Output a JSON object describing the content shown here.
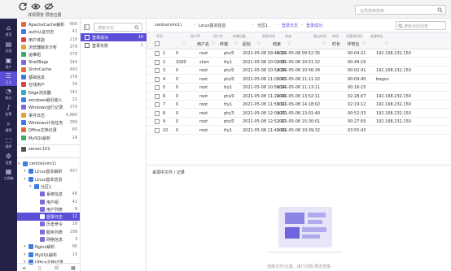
{
  "topbar": {
    "label": "详情预览 预览位置",
    "search_placeholder": "全局搜索搜索"
  },
  "rail": {
    "items": [
      {
        "label": "首页",
        "icon": "home-icon",
        "active": false
      },
      {
        "label": "文档",
        "icon": "doc-icon",
        "active": false
      },
      {
        "label": "资产",
        "icon": "asset-icon",
        "active": false
      },
      {
        "label": "日志",
        "icon": "log-icon",
        "active": true
      },
      {
        "label": "统计",
        "icon": "chart-icon",
        "active": false
      },
      {
        "label": "告警",
        "icon": "bell-icon",
        "active": false
      },
      {
        "label": "搜索",
        "icon": "search-icon",
        "active": false
      },
      {
        "label": "插件",
        "icon": "plugin-icon",
        "active": false
      },
      {
        "label": "设置",
        "icon": "gear-icon",
        "active": false
      },
      {
        "label": "工具箱",
        "icon": "toolbox-icon",
        "active": false
      }
    ]
  },
  "tree_top": [
    {
      "label": "ApacheCache解析",
      "count": "669"
    },
    {
      "label": "auth认证日志",
      "count": "41"
    },
    {
      "label": "用户体验",
      "count": "118"
    },
    {
      "label": "浏览器版本分析",
      "count": "379"
    },
    {
      "label": "运维组",
      "count": "278"
    },
    {
      "label": "ShellBags",
      "count": "244"
    },
    {
      "label": "ShimCache",
      "count": "493"
    },
    {
      "label": "基础信息",
      "count": "178"
    },
    {
      "label": "在线用户",
      "count": "34"
    },
    {
      "label": "Edge浏览器",
      "count": "142"
    },
    {
      "label": "windows最近输入",
      "count": "22"
    },
    {
      "label": "Windows运行记录",
      "count": "170"
    },
    {
      "label": "事件日志",
      "count": "4,880"
    },
    {
      "label": "Windows计划任务",
      "count": "289"
    },
    {
      "label": "Office文档记录",
      "count": "65"
    },
    {
      "label": "MySQL解析",
      "count": "14"
    }
  ],
  "tree_server": "server.101",
  "tree_bottom": [
    {
      "label": "centos(vim1)",
      "count": "",
      "indent": 0
    },
    {
      "label": "Linux基本解析",
      "count": "437",
      "indent": 1
    },
    {
      "label": "Linux基本信息",
      "count": "",
      "indent": 1
    },
    {
      "label": "分区1",
      "count": "",
      "indent": 2
    },
    {
      "label": "系统信息",
      "count": "48",
      "indent": 3
    },
    {
      "label": "用户组",
      "count": "43",
      "indent": 3
    },
    {
      "label": "用户列表",
      "count": "8",
      "indent": 3
    },
    {
      "label": "登录日志",
      "count": "11",
      "indent": 3,
      "selected": true
    },
    {
      "label": "历史命令",
      "count": "18",
      "indent": 3
    },
    {
      "label": "服务列表",
      "count": "198",
      "indent": 3
    },
    {
      "label": "网络信息",
      "count": "3",
      "indent": 3
    },
    {
      "label": "Nginx解析",
      "count": "96",
      "indent": 1
    },
    {
      "label": "MySQL解析",
      "count": "19",
      "indent": 1
    },
    {
      "label": "Office文档记录",
      "count": "",
      "indent": 1
    }
  ],
  "logpanel": {
    "search_placeholder": "搜索日志",
    "items": [
      {
        "label": "登录成功",
        "count": "10",
        "selected": true
      },
      {
        "label": "登录失败",
        "count": "1",
        "selected": false
      }
    ]
  },
  "breadcrumb": [
    "centos(vim1)",
    "Linux基本信息",
    "分区1",
    "登录日志",
    "登录成功"
  ],
  "content_search_placeholder": "搜索当前列表",
  "table": {
    "group_headers": [
      "序号",
      "用户ID",
      "用户名",
      "终端设备",
      "登录时间",
      "状态",
      "登出时间",
      "持续",
      "总登录时间",
      "来源地址"
    ],
    "headers": [
      "",
      "用户名",
      "终端",
      "起始",
      "结束",
      "",
      "时长",
      "IP地址",
      ""
    ],
    "rows": [
      {
        "no": "1",
        "uid": "0",
        "user": "root",
        "tty": "pts/0",
        "start": "2021-05-08 09:48:14",
        "end": "2021-05-08 09:52:35",
        "dur": "00:04:21",
        "ip": "192.168.232.150"
      },
      {
        "no": "2",
        "uid": "1000",
        "user": "shen",
        "tty": "tty1",
        "start": "2021-05-08 10:02:06",
        "end": "2021-05-08 10:51:22",
        "dur": "00:49:16",
        "ip": ""
      },
      {
        "no": "3",
        "uid": "0",
        "user": "root",
        "tty": "pts/0",
        "start": "2021-05-08 10:54:34",
        "end": "2021-05-08 10:56:34",
        "dur": "00:02:41",
        "ip": "192.168.232.150"
      },
      {
        "no": "4",
        "uid": "0",
        "user": "root",
        "tty": "pts/0",
        "start": "2021-05-08 11:01:42",
        "end": "2021-05-08 11:11:22",
        "dur": "00:09:40",
        "ip": "bogon"
      },
      {
        "no": "5",
        "uid": "0",
        "user": "root",
        "tty": "tty1",
        "start": "2021-05-08 10:56:54",
        "end": "2021-05-08 11:13:11",
        "dur": "00:16:15",
        "ip": ""
      },
      {
        "no": "6",
        "uid": "0",
        "user": "root",
        "tty": "pts/0",
        "start": "2021-05-08 11:24:04",
        "end": "2021-05-08 13:52:11",
        "dur": "02:28:07",
        "ip": "192.168.232.150"
      },
      {
        "no": "7",
        "uid": "0",
        "user": "root",
        "tty": "tty1",
        "start": "2021-05-08 11:55:50",
        "end": "2021-05-08 14:18:02",
        "dur": "02:19:12",
        "ip": "192.168.232.150"
      },
      {
        "no": "8",
        "uid": "0",
        "user": "root",
        "tty": "pts/3",
        "start": "2021-05-08 12:09:07",
        "end": "2021-05-08 13:01:40",
        "dur": "00:52:33",
        "ip": "192.168.232.150"
      },
      {
        "no": "9",
        "uid": "0",
        "user": "root",
        "tty": "pts/0",
        "start": "2021-05-08 12:52:42",
        "end": "2021-05-08 15:30:01",
        "dur": "00:27:59",
        "ip": "192.168.232.150"
      },
      {
        "no": "10",
        "uid": "0",
        "user": "root",
        "tty": "tty1",
        "start": "2021-05-08 11:43:49",
        "end": "2021-05-08 10:39:32",
        "dur": "03:55:43",
        "ip": ""
      }
    ]
  },
  "bottom_panel": {
    "title": "来源中文件 / 记录",
    "empty_caption": "选择文件/记录，进行详情/预览查看"
  },
  "colors": {
    "accent": "#5a4fd6",
    "rail": "#23234a"
  }
}
